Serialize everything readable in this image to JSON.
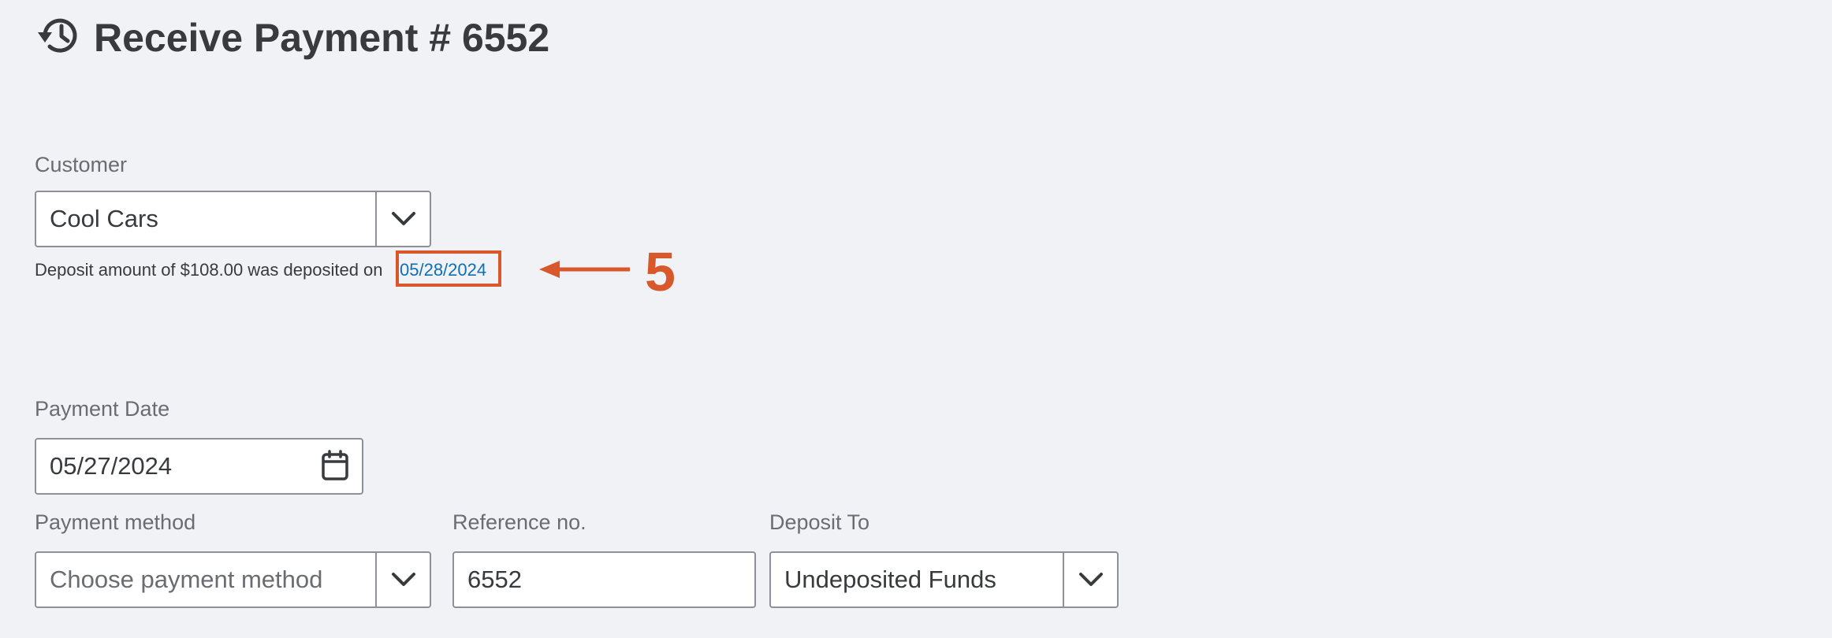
{
  "header": {
    "title": "Receive Payment # 6552",
    "icon": "history-icon"
  },
  "customer": {
    "label": "Customer",
    "value": "Cool Cars"
  },
  "deposit_note": {
    "text": "Deposit amount of $108.00 was deposited on",
    "date_link": "05/28/2024"
  },
  "annotation": {
    "number": "5",
    "color": "#d9582b"
  },
  "payment_date": {
    "label": "Payment Date",
    "value": "05/27/2024"
  },
  "payment_method": {
    "label": "Payment method",
    "placeholder": "Choose payment method"
  },
  "reference": {
    "label": "Reference no.",
    "value": "6552"
  },
  "deposit_to": {
    "label": "Deposit To",
    "value": "Undeposited Funds"
  },
  "colors": {
    "background": "#f1f2f6",
    "link": "#0d6fb8",
    "annotation": "#d9582b",
    "border": "#8d9096"
  }
}
